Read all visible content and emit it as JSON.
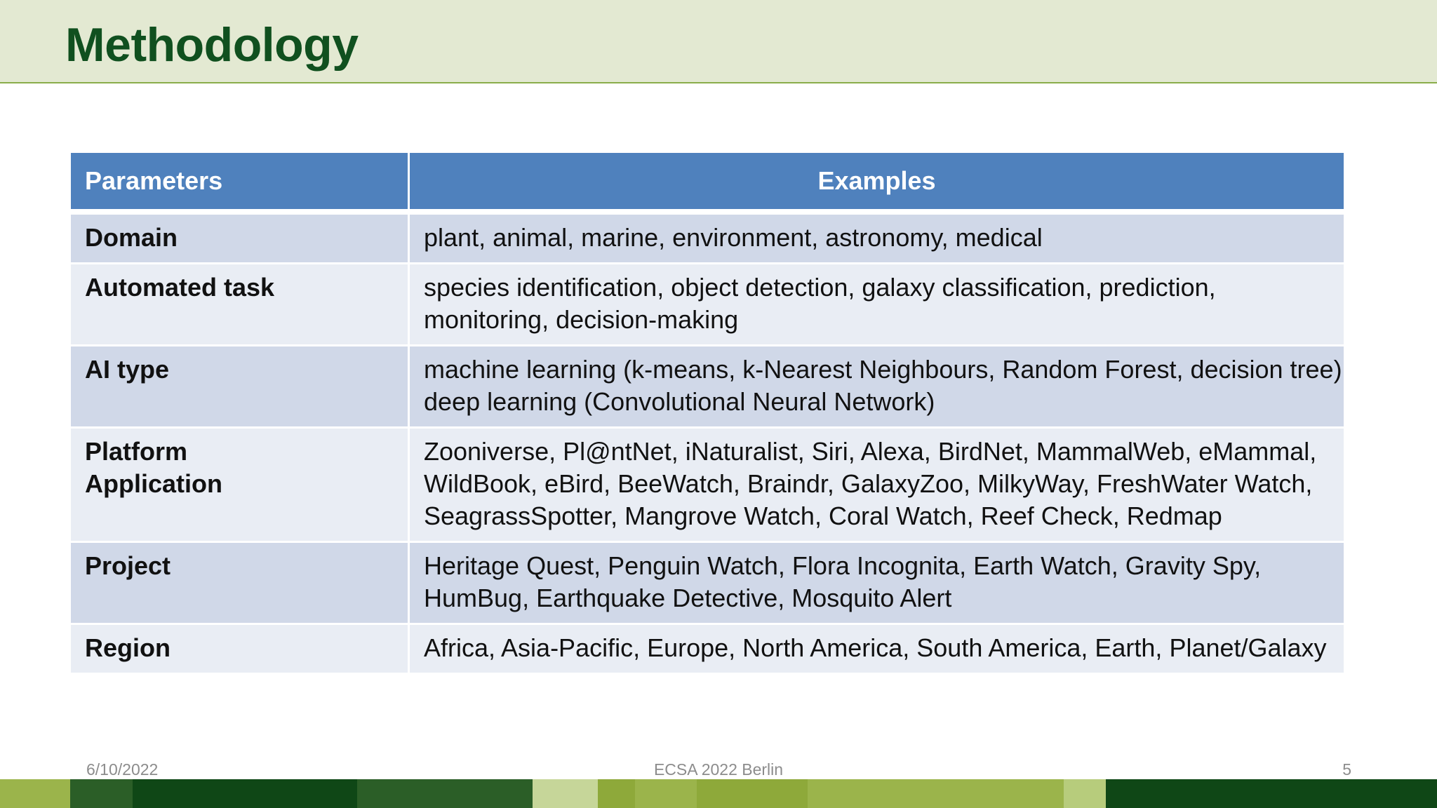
{
  "slide": {
    "title": "Methodology"
  },
  "table": {
    "headers": [
      "Parameters",
      "Examples"
    ],
    "rows": [
      {
        "parameter": [
          "Domain"
        ],
        "examples": [
          "plant, animal, marine, environment, astronomy, medical"
        ]
      },
      {
        "parameter": [
          "Automated task"
        ],
        "examples": [
          "species identification, object detection, galaxy classification, prediction,",
          "monitoring, decision-making"
        ]
      },
      {
        "parameter": [
          "AI type"
        ],
        "examples": [
          "machine learning (k-means, k-Nearest Neighbours, Random Forest, decision tree)",
          "deep learning (Convolutional Neural Network)"
        ]
      },
      {
        "parameter": [
          "Platform",
          "Application"
        ],
        "examples": [
          "Zooniverse, Pl@ntNet, iNaturalist, Siri, Alexa, BirdNet, MammalWeb, eMammal,",
          "WildBook, eBird, BeeWatch, Braindr, GalaxyZoo, MilkyWay, FreshWater Watch,",
          "SeagrassSpotter, Mangrove Watch, Coral Watch, Reef Check, Redmap"
        ]
      },
      {
        "parameter": [
          "Project"
        ],
        "examples": [
          "Heritage Quest, Penguin Watch, Flora Incognita, Earth Watch, Gravity Spy,",
          "HumBug, Earthquake Detective, Mosquito Alert"
        ]
      },
      {
        "parameter": [
          "Region"
        ],
        "examples": [
          "Africa, Asia-Pacific, Europe, North America, South America, Earth, Planet/Galaxy"
        ]
      }
    ]
  },
  "footer": {
    "date": "6/10/2022",
    "conference": "ECSA 2022 Berlin",
    "page_number": "5"
  },
  "colors": {
    "title_green": "#10501f",
    "header_blue": "#4f81bd",
    "row_dark": "#d0d8e8",
    "row_light": "#e9edf4",
    "bar_palette": [
      "#9bb44b",
      "#2b5e27",
      "#0f4716",
      "#2b5e27",
      "#c6d699",
      "#8ea93a",
      "#9bb44b",
      "#8ea93a",
      "#9bb44b",
      "#b7cc7c",
      "#0f4716"
    ]
  }
}
